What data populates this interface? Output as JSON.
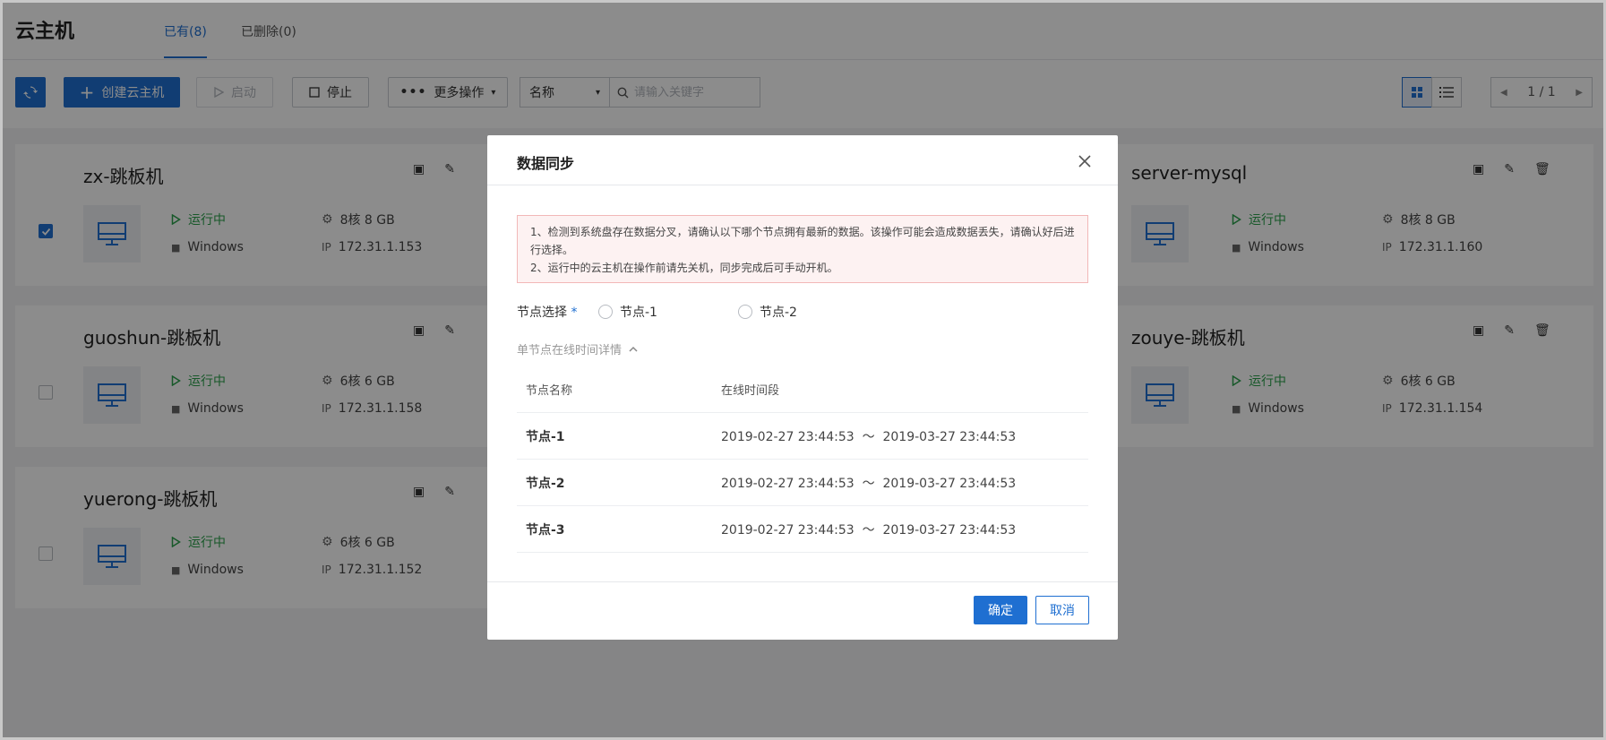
{
  "page": {
    "title": "云主机"
  },
  "tabs": [
    {
      "label": "已有(8)",
      "active": true
    },
    {
      "label": "已删除(0)",
      "active": false
    }
  ],
  "toolbar": {
    "create_label": "创建云主机",
    "start_label": "启动",
    "stop_label": "停止",
    "more_label": "更多操作",
    "filter_select": "名称",
    "search_placeholder": "请输入关键字",
    "pager": "1 / 1"
  },
  "cards": [
    {
      "name": "zx-跳板机",
      "status": "运行中",
      "os": "Windows",
      "spec": "8核 8 GB",
      "ip": "172.31.1.153",
      "ip_label": "IP",
      "checked": true
    },
    {
      "name": "guoshun-跳板机",
      "status": "运行中",
      "os": "Windows",
      "spec": "6核 6 GB",
      "ip": "172.31.1.158",
      "ip_label": "IP",
      "checked": false
    },
    {
      "name": "yuerong-跳板机",
      "status": "运行中",
      "os": "Windows",
      "spec": "6核 6 GB",
      "ip": "172.31.1.152",
      "ip_label": "IP",
      "checked": false
    },
    {
      "name": "server-mysql",
      "status": "运行中",
      "os": "Windows",
      "spec": "8核 8 GB",
      "ip": "172.31.1.160",
      "ip_label": "IP"
    },
    {
      "name": "zouye-跳板机",
      "status": "运行中",
      "os": "Windows",
      "spec": "6核 6 GB",
      "ip": "172.31.1.154",
      "ip_label": "IP"
    }
  ],
  "modal": {
    "title": "数据同步",
    "alert_line1": "1、检测到系统盘存在数据分叉，请确认以下哪个节点拥有最新的数据。该操作可能会造成数据丢失，请确认好后进行选择。",
    "alert_line2": "2、运行中的云主机在操作前请先关机，同步完成后可手动开机。",
    "field_label": "节点选择",
    "required_mark": "*",
    "radios": [
      "节点-1",
      "节点-2"
    ],
    "collapse_label": "单节点在线时间详情",
    "table": {
      "headers": [
        "节点名称",
        "在线时间段"
      ],
      "rows": [
        {
          "node": "节点-1",
          "period": "2019-02-27 23:44:53  ～  2019-03-27 23:44:53"
        },
        {
          "node": "节点-2",
          "period": "2019-02-27 23:44:53  ～  2019-03-27 23:44:53"
        },
        {
          "node": "节点-3",
          "period": "2019-02-27 23:44:53  ～  2019-03-27 23:44:53"
        }
      ]
    },
    "ok_label": "确定",
    "cancel_label": "取消"
  },
  "colors": {
    "primary": "#1f6fd1",
    "running": "#2aa14b",
    "alert_bg": "#fdf2f2"
  }
}
